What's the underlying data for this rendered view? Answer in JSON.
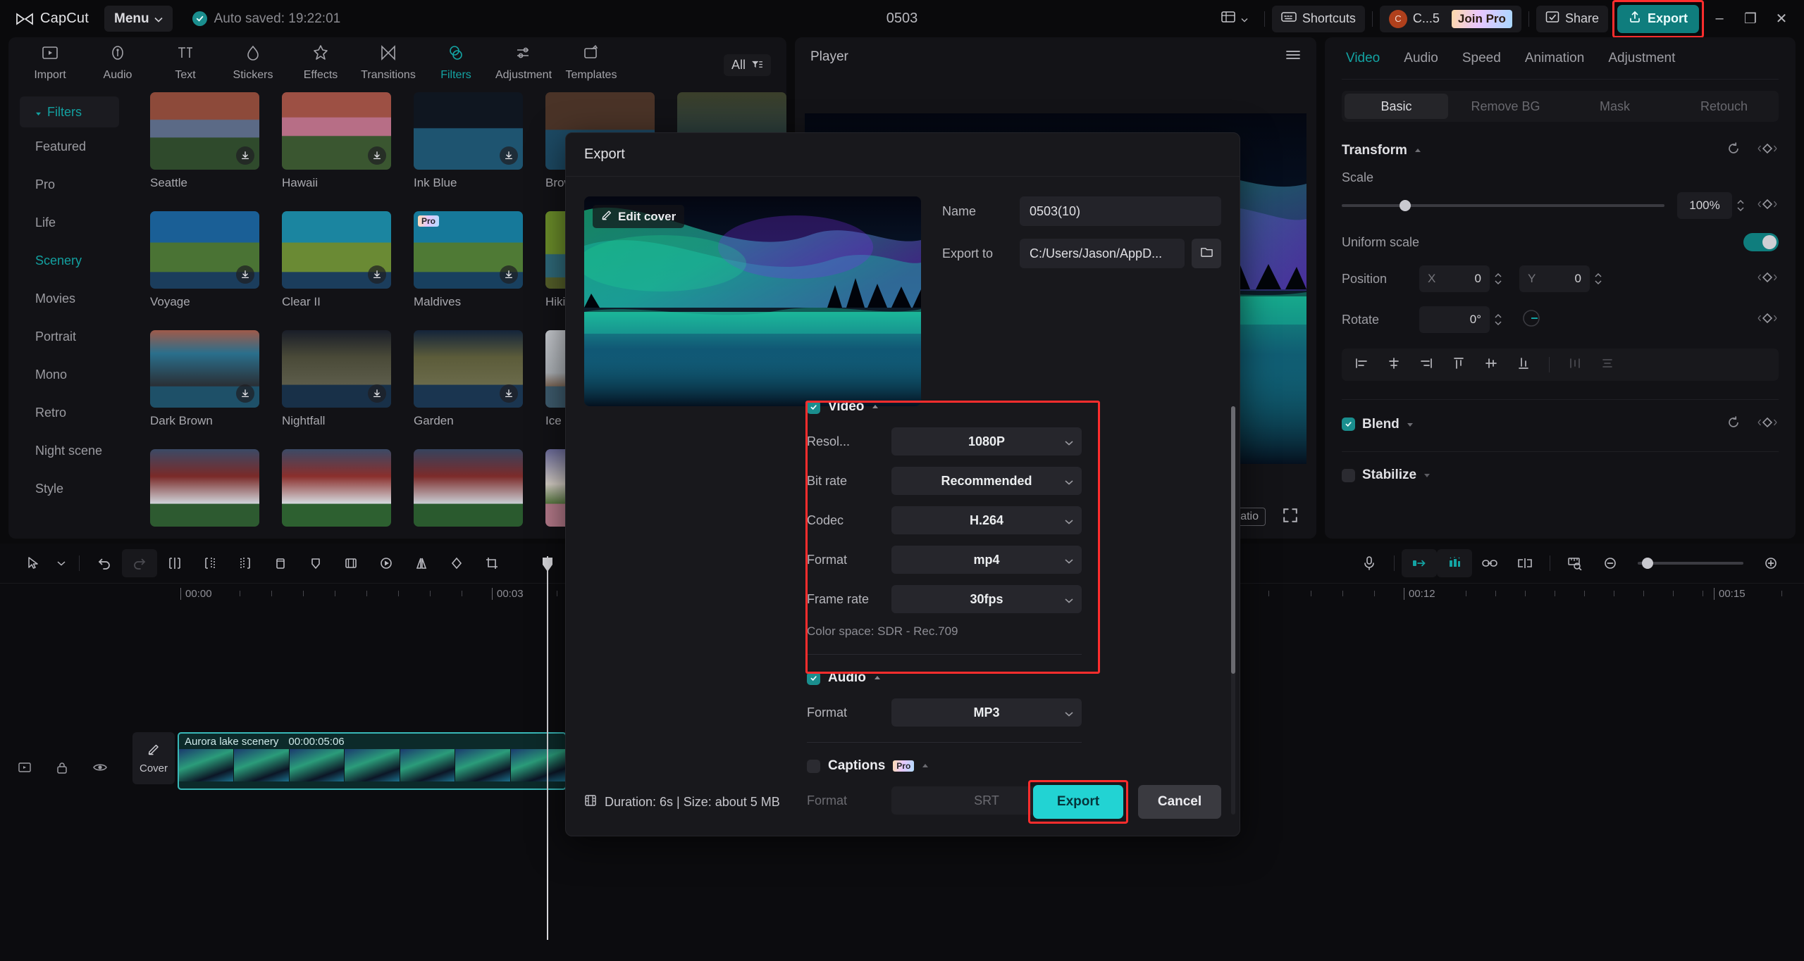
{
  "titlebar": {
    "brand": "CapCut",
    "menu_label": "Menu",
    "autosave": "Auto saved: 19:22:01",
    "project_title": "0503",
    "layout_icon": "layout-icon",
    "shortcuts_label": "Shortcuts",
    "account_initial": "C",
    "account_label": "C...5",
    "join_pro_label": "Join Pro",
    "share_label": "Share",
    "export_label": "Export",
    "minimize": "–",
    "restore": "❐",
    "close": "✕"
  },
  "left_panel": {
    "tabs": [
      {
        "label": "Import",
        "icon": "import-icon",
        "active": false
      },
      {
        "label": "Audio",
        "icon": "audio-icon",
        "active": false
      },
      {
        "label": "Text",
        "icon": "text-icon",
        "active": false
      },
      {
        "label": "Stickers",
        "icon": "stickers-icon",
        "active": false
      },
      {
        "label": "Effects",
        "icon": "effects-icon",
        "active": false
      },
      {
        "label": "Transitions",
        "icon": "transitions-icon",
        "active": false
      },
      {
        "label": "Filters",
        "icon": "filters-icon",
        "active": true
      },
      {
        "label": "Adjustment",
        "icon": "adjustment-icon",
        "active": false
      },
      {
        "label": "Templates",
        "icon": "templates-icon",
        "active": false
      }
    ],
    "section_header": "Filters",
    "categories": [
      {
        "label": "Featured",
        "active": false
      },
      {
        "label": "Pro",
        "active": false
      },
      {
        "label": "Life",
        "active": false
      },
      {
        "label": "Scenery",
        "active": true
      },
      {
        "label": "Movies",
        "active": false
      },
      {
        "label": "Portrait",
        "active": false
      },
      {
        "label": "Mono",
        "active": false
      },
      {
        "label": "Retro",
        "active": false
      },
      {
        "label": "Night scene",
        "active": false
      },
      {
        "label": "Style",
        "active": false
      }
    ],
    "filter_sort_label": "All",
    "filters": [
      {
        "label": "Seattle",
        "pro": false
      },
      {
        "label": "Hawaii",
        "pro": false
      },
      {
        "label": "Ink Blue",
        "pro": false
      },
      {
        "label": "Brownstone",
        "pro": false
      },
      {
        "label": "",
        "pro": false
      },
      {
        "label": "Voyage",
        "pro": false
      },
      {
        "label": "Clear II",
        "pro": false
      },
      {
        "label": "Maldives",
        "pro": true
      },
      {
        "label": "Hiking",
        "pro": false
      },
      {
        "label": "",
        "pro": false
      },
      {
        "label": "Dark Brown",
        "pro": false
      },
      {
        "label": "Nightfall",
        "pro": false
      },
      {
        "label": "Garden",
        "pro": false
      },
      {
        "label": "Ice City",
        "pro": false
      },
      {
        "label": "",
        "pro": false
      }
    ]
  },
  "player": {
    "title": "Player",
    "menu_icon": "hamburger-icon",
    "ratio_label": "Ratio",
    "fullscreen_icon": "fullscreen-icon"
  },
  "right_panel": {
    "tabs": [
      {
        "label": "Video",
        "active": true
      },
      {
        "label": "Audio",
        "active": false
      },
      {
        "label": "Speed",
        "active": false
      },
      {
        "label": "Animation",
        "active": false
      },
      {
        "label": "Adjustment",
        "active": false
      }
    ],
    "subtabs": [
      {
        "label": "Basic",
        "active": true
      },
      {
        "label": "Remove BG",
        "active": false
      },
      {
        "label": "Mask",
        "active": false
      },
      {
        "label": "Retouch",
        "active": false
      }
    ],
    "transform": {
      "title": "Transform",
      "scale_label": "Scale",
      "scale_value": "100%",
      "uniform_scale_label": "Uniform scale",
      "uniform_scale_on": true,
      "position_label": "Position",
      "position_x_axis": "X",
      "position_x": "0",
      "position_y_axis": "Y",
      "position_y": "0",
      "rotate_label": "Rotate",
      "rotate_value": "0°",
      "reset_icon": "reset-icon",
      "keyframe_icon": "keyframe-diamond-icon"
    },
    "align_icons": [
      "align-left-icon",
      "align-center-horizontal-icon",
      "align-right-icon",
      "align-top-icon",
      "align-middle-vertical-icon",
      "align-bottom-icon",
      "distribute-horizontal-icon",
      "distribute-vertical-icon"
    ],
    "blend": {
      "title": "Blend",
      "enabled": true
    },
    "stabilize": {
      "title": "Stabilize",
      "enabled": false
    }
  },
  "timeline": {
    "tools": [
      "select-cursor-icon",
      "chevron-down-icon",
      "undo-icon",
      "redo-icon",
      "split-icon",
      "trim-left-icon",
      "trim-right-icon",
      "delete-icon",
      "keyframe-icon",
      "freeze-frame-icon",
      "reverse-icon",
      "mirror-icon",
      "rotate-icon",
      "crop-icon"
    ],
    "right_tools": [
      "microphone-icon",
      "auto-cut-icon",
      "auto-beat-icon",
      "link-icon",
      "detach-icon",
      "ruler-icon",
      "zoom-out-icon",
      "zoom-in-icon"
    ],
    "ruler_labels": [
      "00:00",
      "00:03",
      "00:12",
      "00:15"
    ],
    "track_icons": [
      "track-preview-icon",
      "lock-icon",
      "eye-icon",
      "volume-icon"
    ],
    "cover_label": "Cover",
    "cover_icon": "edit-pencil-icon",
    "clip": {
      "name": "Aurora lake scenery",
      "duration": "00:00:05:06"
    }
  },
  "export_dialog": {
    "title": "Export",
    "edit_cover_label": "Edit cover",
    "edit_cover_icon": "edit-pencil-icon",
    "name_label": "Name",
    "name_value": "0503(10)",
    "export_to_label": "Export to",
    "export_to_value": "C:/Users/Jason/AppD...",
    "folder_icon": "folder-icon",
    "video": {
      "title": "Video",
      "enabled": true,
      "rows": [
        {
          "label": "Resol...",
          "value": "1080P"
        },
        {
          "label": "Bit rate",
          "value": "Recommended"
        },
        {
          "label": "Codec",
          "value": "H.264"
        },
        {
          "label": "Format",
          "value": "mp4"
        },
        {
          "label": "Frame rate",
          "value": "30fps"
        }
      ],
      "color_space": "Color space: SDR - Rec.709"
    },
    "audio": {
      "title": "Audio",
      "enabled": true,
      "rows": [
        {
          "label": "Format",
          "value": "MP3"
        }
      ]
    },
    "captions": {
      "title": "Captions",
      "pro_badge": "Pro",
      "enabled": false,
      "rows": [
        {
          "label": "Format",
          "value": "SRT"
        }
      ]
    },
    "footer": {
      "info_icon": "film-icon",
      "duration_text": "Duration: 6s | Size: about 5 MB",
      "export_label": "Export",
      "cancel_label": "Cancel"
    }
  },
  "colors": {
    "accent_teal": "#13a3a3",
    "accent_cyan": "#22d3d3",
    "highlight_red": "#ff2d2d",
    "panel_bg": "#121216",
    "window_bg": "#0a0a0c"
  }
}
